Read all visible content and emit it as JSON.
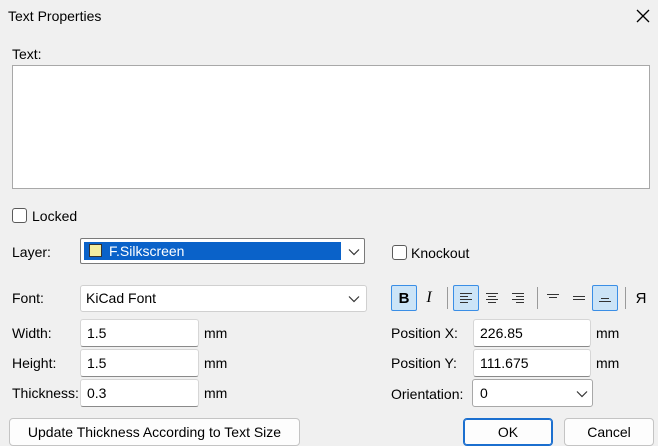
{
  "dialog": {
    "title": "Text Properties",
    "close_icon": "close-icon"
  },
  "text_section": {
    "label": "Text:",
    "value": ""
  },
  "locked": {
    "label": "Locked",
    "checked": false
  },
  "layer": {
    "label": "Layer:",
    "value": "F.Silkscreen",
    "swatch_color": "#f2eda1"
  },
  "knockout": {
    "label": "Knockout",
    "checked": false
  },
  "font": {
    "label": "Font:",
    "value": "KiCad Font"
  },
  "style_toolbar": {
    "bold_label": "B",
    "italic_label": "I",
    "mirror_label": "Я",
    "bold_active": true,
    "h_align_active": "left",
    "v_align_active": "bottom"
  },
  "width": {
    "label": "Width:",
    "value": "1.5",
    "unit": "mm"
  },
  "height": {
    "label": "Height:",
    "value": "1.5",
    "unit": "mm"
  },
  "thickness": {
    "label": "Thickness:",
    "value": "0.3",
    "unit": "mm"
  },
  "position_x": {
    "label": "Position X:",
    "value": "226.85",
    "unit": "mm"
  },
  "position_y": {
    "label": "Position Y:",
    "value": "111.675",
    "unit": "mm"
  },
  "orientation": {
    "label": "Orientation:",
    "value": "0"
  },
  "buttons": {
    "update_thickness": "Update Thickness According to Text Size",
    "ok": "OK",
    "cancel": "Cancel"
  },
  "colors": {
    "selection": "#0a62c9",
    "toggle_active_bg": "#cce4f7",
    "toggle_active_border": "#3a8ee6"
  }
}
